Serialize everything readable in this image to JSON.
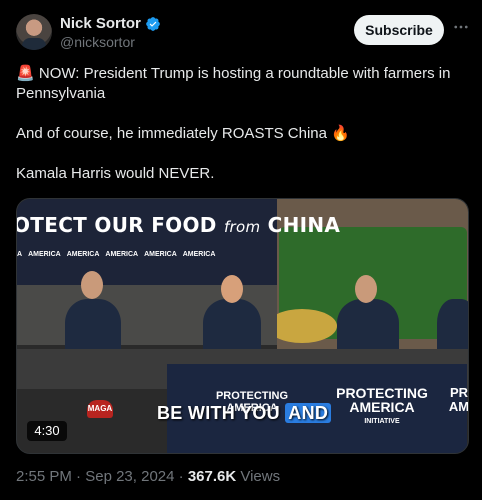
{
  "author": {
    "name": "Nick Sortor",
    "handle": "@nicksortor",
    "verified": true
  },
  "actions": {
    "subscribe_label": "Subscribe",
    "more_icon": "more-icon"
  },
  "tweet": {
    "line1_emoji": "🚨",
    "line1": " NOW: President Trump is hosting a roundtable with farmers in Pennsylvania",
    "line2": "And of course, he immediately ROASTS China",
    "line2_emoji": "🔥",
    "line3": "Kamala Harris would NEVER."
  },
  "media": {
    "banner_title": "OTECT OUR FOOD",
    "banner_from": "from",
    "banner_china": "CHINA",
    "logo_texts": [
      "A",
      "AMERICA",
      "AMERICA",
      "AMERICA",
      "AMERICA",
      "AMERICA"
    ],
    "front_text_1": "PROTECTING\nAMERICA",
    "front_text_2": "PROTECTING\nAMERICA",
    "front_sub_2": "INITIATIVE",
    "front_text_3": "PR\nAM",
    "caption_before": "BE WITH YOU ",
    "caption_highlight": "AND",
    "hat_text": "MAGA",
    "duration": "4:30"
  },
  "meta": {
    "time": "2:55 PM",
    "separator": " · ",
    "date": "Sep 23, 2024",
    "views_count": "367.6K",
    "views_label": " Views"
  },
  "colors": {
    "background": "#000000",
    "text": "#e7e9ea",
    "secondary": "#71767b",
    "verified": "#1d9bf0",
    "caption_highlight": "#2a7de1"
  }
}
